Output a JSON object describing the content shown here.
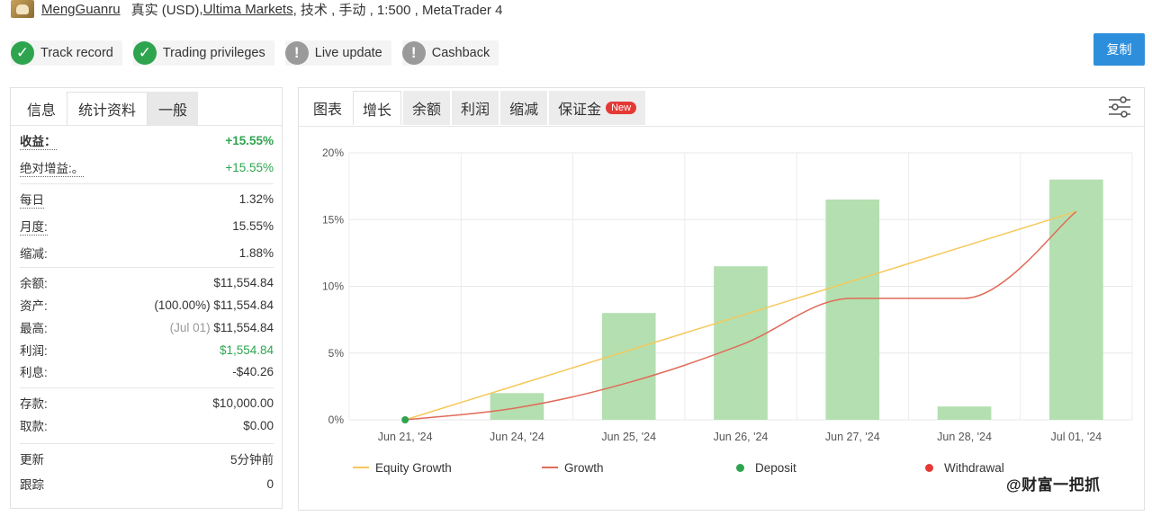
{
  "header": {
    "username": "MengGuanru",
    "account_type": "真实 (USD)",
    "sep1": ", ",
    "broker": "Ultima Markets",
    "details": " , 技术 , 手动 , 1:500 , MetaTrader 4"
  },
  "badges": [
    {
      "label": "Track record",
      "status": "verified",
      "icon": "check-icon"
    },
    {
      "label": "Trading privileges",
      "status": "verified",
      "icon": "check-icon"
    },
    {
      "label": "Live update",
      "status": "unverified",
      "icon": "exclamation-icon"
    },
    {
      "label": "Cashback",
      "status": "unverified",
      "icon": "exclamation-icon"
    }
  ],
  "copy_button": "复制",
  "left_tabs": [
    "信息",
    "统计资料",
    "一般"
  ],
  "stats": {
    "gain_label": "收益：",
    "gain_value": "+15.55%",
    "abs_gain_label": "绝对增益:。",
    "abs_gain_value": "+15.55%",
    "daily_label": "每日",
    "daily_value": "1.32%",
    "monthly_label": "月度:",
    "monthly_value": "15.55%",
    "drawdown_label": "缩减:",
    "drawdown_value": "1.88%",
    "balance_label": "余额:",
    "balance_value": "$11,554.84",
    "equity_label": "资产:",
    "equity_pct": "(100.00%)",
    "equity_value": "$11,554.84",
    "highest_label": "最高:",
    "highest_date": "(Jul 01)",
    "highest_value": "$11,554.84",
    "profit_label": "利润:",
    "profit_value": "$1,554.84",
    "interest_label": "利息:",
    "interest_value": "-$40.26",
    "deposits_label": "存款:",
    "deposits_value": "$10,000.00",
    "withdrawals_label": "取款:",
    "withdrawals_value": "$0.00",
    "updated_label": "更新",
    "updated_value": "5分钟前",
    "tracking_label": "跟踪",
    "tracking_value": "0"
  },
  "right_tabs": [
    "图表",
    "增长",
    "余额",
    "利润",
    "缩减",
    "保证金"
  ],
  "new_badge": "New",
  "colors": {
    "accent": "#2d8fdc",
    "positive": "#2ea44f",
    "bar": "#b4dfb0",
    "equity_line": "#f5c85a",
    "growth_line": "#e06b5a",
    "deposit": "#2ea44f",
    "withdrawal": "#e53935"
  },
  "chart_data": {
    "type": "bar",
    "categories": [
      "Jun 21, '24",
      "Jun 24, '24",
      "Jun 25, '24",
      "Jun 26, '24",
      "Jun 27, '24",
      "Jun 28, '24",
      "Jul 01, '24"
    ],
    "ylim": [
      0,
      20
    ],
    "yticks": [
      "0%",
      "5%",
      "10%",
      "15%",
      "20%"
    ],
    "grid": true,
    "legend_position": "bottom",
    "series": [
      {
        "name": "Equity Growth",
        "kind": "line",
        "values": [
          0,
          2.6,
          5.2,
          7.8,
          10.4,
          13.0,
          15.6
        ]
      },
      {
        "name": "Growth",
        "kind": "line",
        "values": [
          0,
          0.9,
          2.8,
          5.6,
          9.1,
          9.1,
          15.6
        ]
      },
      {
        "name": "Deposit",
        "kind": "marker",
        "values": [
          0,
          null,
          null,
          null,
          null,
          null,
          null
        ]
      },
      {
        "name": "Withdrawal",
        "kind": "marker",
        "values": [
          null,
          null,
          null,
          null,
          null,
          null,
          null
        ]
      },
      {
        "name": "",
        "kind": "bar",
        "values": [
          0,
          2.0,
          8.0,
          11.5,
          16.5,
          1.0,
          18.0
        ]
      }
    ]
  },
  "watermark": "@财富一把抓"
}
